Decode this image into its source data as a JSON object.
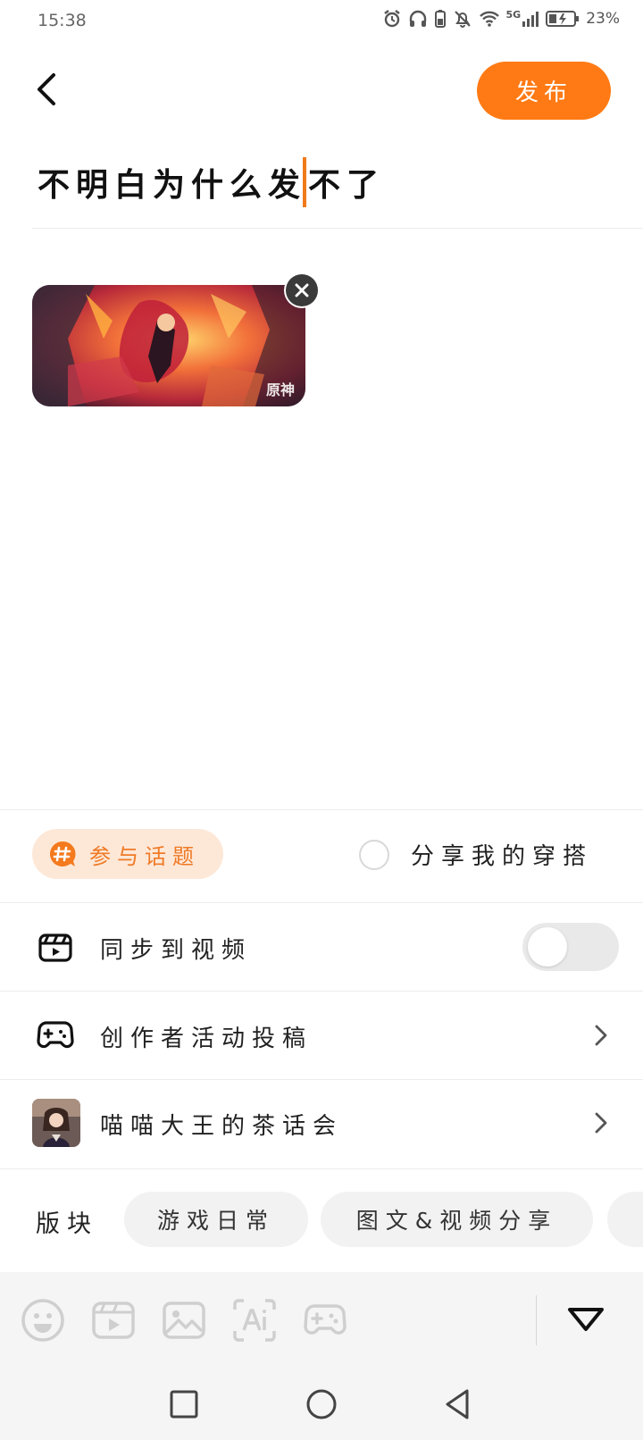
{
  "status_bar": {
    "time": "15:38",
    "battery_percent": "23%",
    "network": "5G",
    "icons": [
      "alarm-icon",
      "headphones-icon",
      "battery-saver-icon",
      "mute-icon",
      "wifi-icon",
      "signal-icon",
      "battery-icon"
    ]
  },
  "header": {
    "back_icon": "chevron-left-icon",
    "publish_label": "发布"
  },
  "post": {
    "title_before_cursor": "不明白为什么发",
    "title_after_cursor": "不了",
    "image": {
      "watermark": "原神",
      "close_icon": "close-icon"
    }
  },
  "options": {
    "topic_label": "参与话题",
    "topic_icon": "hashtag-bubble-icon",
    "outfit_label": "分享我的穿搭",
    "outfit_checked": false,
    "sync_video_label": "同步到视频",
    "sync_video_icon": "clapperboard-icon",
    "sync_video_on": false,
    "creator_activity_label": "创作者活动投稿",
    "creator_activity_icon": "gamepad-icon",
    "club_label": "喵喵大王的茶话会"
  },
  "section": {
    "label": "版块",
    "chips": [
      "游戏日常",
      "图文&视频分享"
    ]
  },
  "toolbar": {
    "icons": [
      "emoji-icon",
      "video-icon",
      "image-icon",
      "ai-icon",
      "game-icon"
    ],
    "collapse_icon": "triangle-down-icon"
  },
  "navbar": {
    "icons": [
      "square-recent-icon",
      "circle-home-icon",
      "triangle-back-icon"
    ]
  },
  "colors": {
    "accent": "#ff7a14",
    "topic_bg": "#fde8d8",
    "chip_bg": "#f2f2f2",
    "toolbar_bg": "#f5f5f5"
  }
}
